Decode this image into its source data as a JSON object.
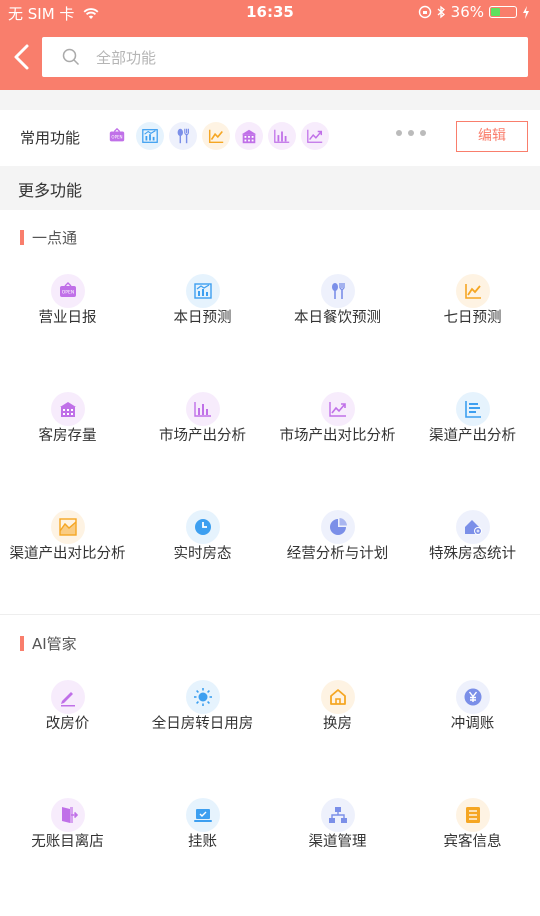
{
  "status_bar": {
    "carrier": "无 SIM 卡",
    "time": "16:35",
    "battery": "36%"
  },
  "search": {
    "placeholder": "全部功能"
  },
  "common": {
    "label": "常用功能",
    "edit_label": "编辑",
    "icons": [
      "open-sign-icon",
      "bar-chart-icon",
      "dining-icon",
      "trend-icon",
      "building-icon",
      "column-chart-icon",
      "growth-chart-icon"
    ]
  },
  "more_label": "更多功能",
  "sections": [
    {
      "title": "一点通",
      "items": [
        {
          "label": "营业日报",
          "icon": "open-sign-icon",
          "color": "#c070e8"
        },
        {
          "label": "本日预测",
          "icon": "bar-chart-icon",
          "color": "#3d9ff0"
        },
        {
          "label": "本日餐饮预测",
          "icon": "dining-icon",
          "color": "#7b8fe8"
        },
        {
          "label": "七日预测",
          "icon": "trend-icon",
          "color": "#f5a623"
        },
        {
          "label": "客房存量",
          "icon": "building-icon",
          "color": "#c070e8"
        },
        {
          "label": "市场产出分析",
          "icon": "column-chart-icon",
          "color": "#c070e8"
        },
        {
          "label": "市场产出对比分析",
          "icon": "growth-chart-icon",
          "color": "#c070e8"
        },
        {
          "label": "渠道产出分析",
          "icon": "list-chart-icon",
          "color": "#3d9ff0"
        },
        {
          "label": "渠道产出对比分析",
          "icon": "area-chart-icon",
          "color": "#f5a623"
        },
        {
          "label": "实时房态",
          "icon": "clock-icon",
          "color": "#3d9ff0"
        },
        {
          "label": "经营分析与计划",
          "icon": "pie-chart-icon",
          "color": "#7b8fe8"
        },
        {
          "label": "特殊房态统计",
          "icon": "house-badge-icon",
          "color": "#7b8fe8"
        }
      ]
    },
    {
      "title": "AI管家",
      "items": [
        {
          "label": "改房价",
          "icon": "pen-icon",
          "color": "#c070e8"
        },
        {
          "label": "全日房转日用房",
          "icon": "sun-icon",
          "color": "#3d9ff0"
        },
        {
          "label": "换房",
          "icon": "home-icon",
          "color": "#f5a623"
        },
        {
          "label": "冲调账",
          "icon": "yen-icon",
          "color": "#7b8fe8"
        },
        {
          "label": "无账目离店",
          "icon": "door-exit-icon",
          "color": "#c070e8"
        },
        {
          "label": "挂账",
          "icon": "laptop-icon",
          "color": "#3d9ff0"
        },
        {
          "label": "渠道管理",
          "icon": "hierarchy-icon",
          "color": "#7b8fe8"
        },
        {
          "label": "宾客信息",
          "icon": "list-doc-icon",
          "color": "#f5a623"
        }
      ]
    }
  ]
}
